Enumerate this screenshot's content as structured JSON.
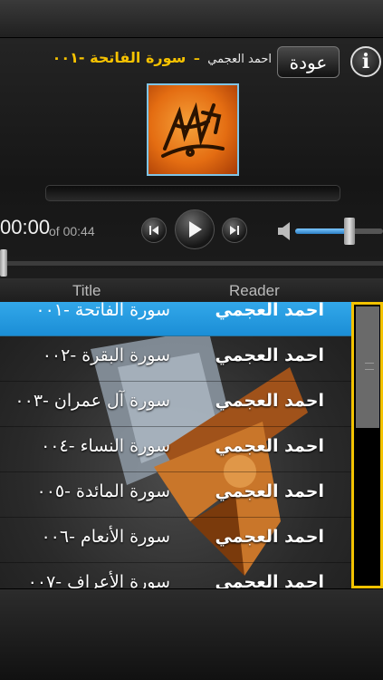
{
  "now_playing": {
    "reader": "احمد العجمي",
    "separator": "–",
    "title": "سورة الفاتحة -٠٠١"
  },
  "header": {
    "back_label": "عودة",
    "info_label": "i"
  },
  "player": {
    "elapsed": "00:00",
    "total": "of 00:44",
    "volume_percent": 62,
    "seek_percent": 0
  },
  "columns": {
    "title": "Title",
    "reader": "Reader"
  },
  "tracks": [
    {
      "title": "سورة الفاتحة -٠٠١",
      "reader": "احمد العجمي",
      "selected": true
    },
    {
      "title": "سورة البقرة -٠٠٢",
      "reader": "احمد العجمي",
      "selected": false
    },
    {
      "title": "سورة آل عمران -٠٠٣",
      "reader": "احمد العجمي",
      "selected": false
    },
    {
      "title": "سورة النساء -٠٠٤",
      "reader": "احمد العجمي",
      "selected": false
    },
    {
      "title": "سورة المائدة -٠٠٥",
      "reader": "احمد العجمي",
      "selected": false
    },
    {
      "title": "سورة الأنعام -٠٠٦",
      "reader": "احمد العجمي",
      "selected": false
    },
    {
      "title": "سورة الأعراف -٠٠٧",
      "reader": "احمد العجمي",
      "selected": false
    }
  ],
  "colors": {
    "accent": "#f6c200",
    "selection": "#1b8ed6"
  },
  "icons": {
    "artwork": "quran-calligraphy-icon",
    "prev": "skip-previous-icon",
    "play": "play-icon",
    "next": "skip-next-icon",
    "volume": "speaker-icon",
    "info": "info-icon"
  }
}
